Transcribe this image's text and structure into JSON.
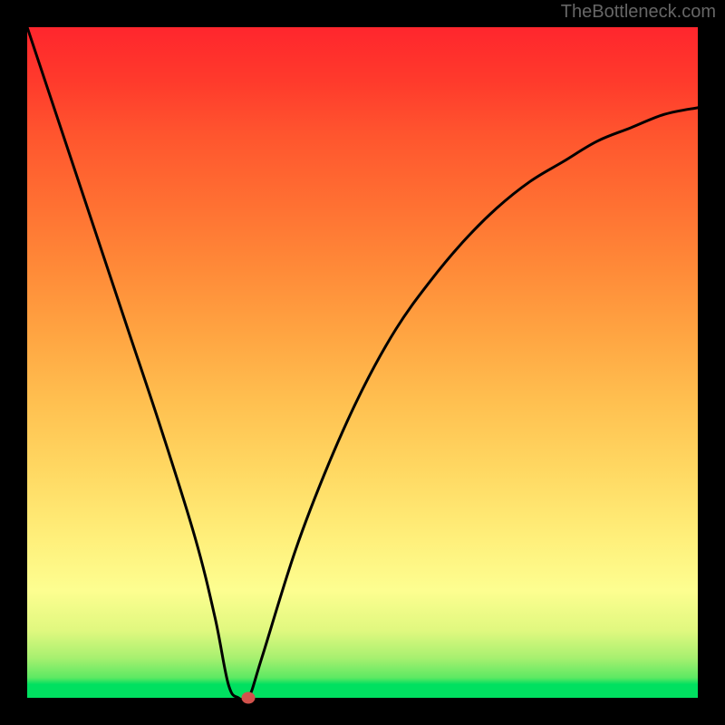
{
  "watermark": "TheBottleneck.com",
  "chart_data": {
    "type": "line",
    "title": "",
    "xlabel": "",
    "ylabel": "",
    "xlim": [
      0,
      100
    ],
    "ylim": [
      0,
      100
    ],
    "x": [
      0,
      5,
      10,
      15,
      20,
      25,
      28,
      30,
      31.5,
      33,
      35,
      40,
      45,
      50,
      55,
      60,
      65,
      70,
      75,
      80,
      85,
      90,
      95,
      100
    ],
    "y": [
      100,
      85,
      70,
      55,
      40,
      24,
      12,
      2,
      0,
      0,
      6,
      22,
      35,
      46,
      55,
      62,
      68,
      73,
      77,
      80,
      83,
      85,
      87,
      88
    ],
    "marker": {
      "x": 33,
      "y": 0
    },
    "gradient_stops": [
      {
        "pos": 0,
        "color": "#00e060"
      },
      {
        "pos": 2,
        "color": "#00e060"
      },
      {
        "pos": 3,
        "color": "#5de963"
      },
      {
        "pos": 6,
        "color": "#a8f070"
      },
      {
        "pos": 10,
        "color": "#e0f87f"
      },
      {
        "pos": 16,
        "color": "#fdfe90"
      },
      {
        "pos": 24,
        "color": "#ffef7a"
      },
      {
        "pos": 34,
        "color": "#ffd862"
      },
      {
        "pos": 44,
        "color": "#ffc050"
      },
      {
        "pos": 54,
        "color": "#ffa542"
      },
      {
        "pos": 64,
        "color": "#ff8a38"
      },
      {
        "pos": 74,
        "color": "#ff6f32"
      },
      {
        "pos": 84,
        "color": "#ff552e"
      },
      {
        "pos": 92,
        "color": "#ff3a2c"
      },
      {
        "pos": 100,
        "color": "#ff262d"
      }
    ]
  }
}
